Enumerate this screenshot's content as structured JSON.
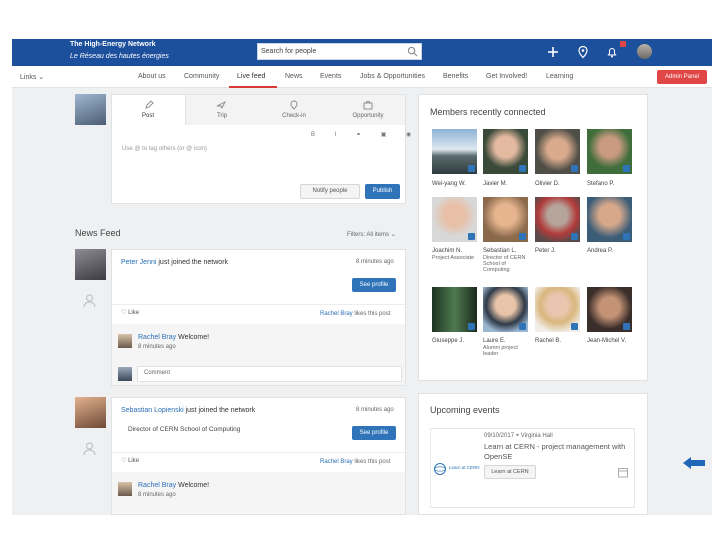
{
  "header": {
    "brand_line1": "The High-Energy Network",
    "brand_line2": "Le Réseau des hautes énergies",
    "search_placeholder": "Search for people",
    "notification_count": ""
  },
  "nav": {
    "links_label": "Links",
    "items": [
      "About us",
      "Community",
      "Live feed",
      "News",
      "Events",
      "Jobs & Opportunities",
      "Benefits",
      "Get Involved!",
      "Learning"
    ],
    "active_index": 2,
    "admin_button": "Admin Panel"
  },
  "composer": {
    "tabs": [
      "Post",
      "Trip",
      "Check-in",
      "Opportunity"
    ],
    "placeholder": "Use @ to tag others (or @ icon)",
    "notify_button": "Notify people",
    "publish_button": "Publish"
  },
  "news_feed": {
    "title": "News Feed",
    "filter_label": "Filters: All items",
    "posts": [
      {
        "author": "Peter Jenni",
        "action": "just joined the network",
        "time": "8 minutes ago",
        "subtitle": "",
        "button": "See profile",
        "like_label": "Like",
        "likes_text": "Rachel Bray likes this post",
        "comment_author": "Rachel Bray",
        "comment_text": "Welcome!",
        "comment_time": "8 minutes ago",
        "comment_placeholder": "Comment"
      },
      {
        "author": "Sebastian Lopienski",
        "action": "just joined the network",
        "time": "8 minutes ago",
        "subtitle": "Director of CERN School of Computing",
        "button": "See profile",
        "like_label": "Like",
        "likes_text": "Rachel Bray likes this post",
        "comment_author": "Rachel Bray",
        "comment_text": "Welcome!",
        "comment_time": "8 minutes ago"
      }
    ]
  },
  "members": {
    "title": "Members recently connected",
    "list": [
      {
        "name": "Wei-yang W.",
        "sub": ""
      },
      {
        "name": "Javier M.",
        "sub": ""
      },
      {
        "name": "Olivier D.",
        "sub": ""
      },
      {
        "name": "Stefano P.",
        "sub": ""
      },
      {
        "name": "Joachim N.",
        "sub": "Project Associate"
      },
      {
        "name": "Sebastian L.",
        "sub": "Director of CERN School of Computing"
      },
      {
        "name": "Peter J.",
        "sub": ""
      },
      {
        "name": "Andrea P.",
        "sub": ""
      },
      {
        "name": "Giuseppe J.",
        "sub": ""
      },
      {
        "name": "Laure E.",
        "sub": "Alumni project leader"
      },
      {
        "name": "Rachel B.",
        "sub": ""
      },
      {
        "name": "Jean-Michel V.",
        "sub": ""
      }
    ]
  },
  "events": {
    "title": "Upcoming events",
    "date": "09/10/2017",
    "location": "Virginia Hall",
    "name": "Learn at CERN - project management with OpenSE",
    "logo_text": "Learn at CERN",
    "button": "Learn at CERN"
  },
  "colors": {
    "header_bg": "#1c4f9c",
    "accent_red": "#e04646",
    "link_blue": "#2a6fb5"
  }
}
